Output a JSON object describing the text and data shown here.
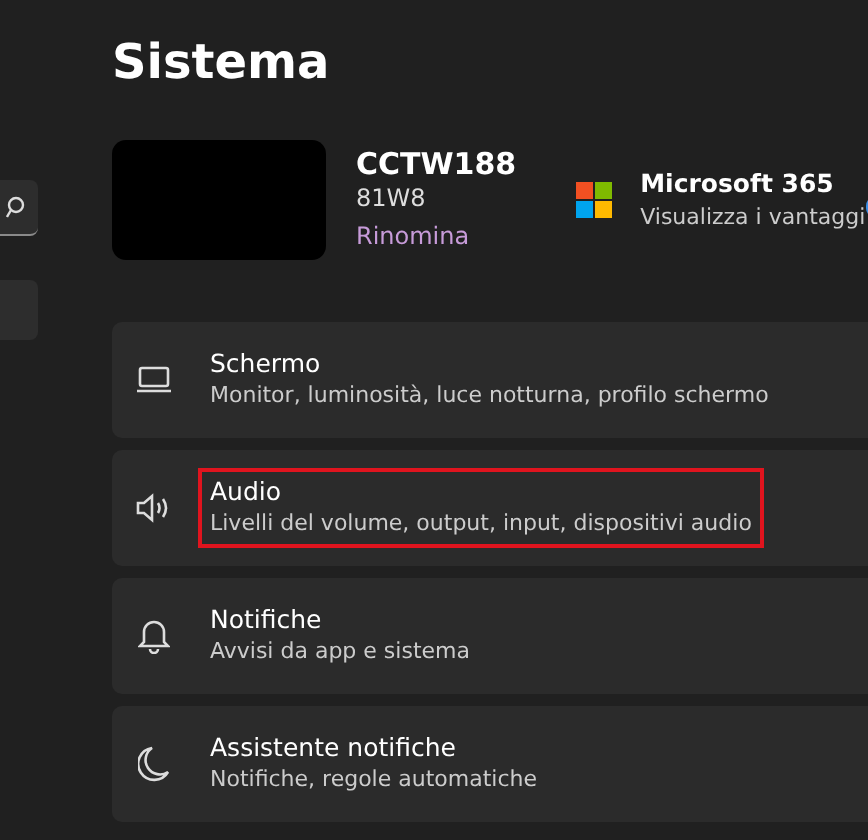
{
  "title": "Sistema",
  "device": {
    "name": "CCTW188",
    "model": "81W8",
    "rename_link": "Rinomina"
  },
  "promo": {
    "title": "Microsoft 365",
    "subtitle": "Visualizza i vantaggi"
  },
  "settings": [
    {
      "kind": "display",
      "title": "Schermo",
      "subtitle": "Monitor, luminosità, luce notturna, profilo schermo",
      "highlighted": false
    },
    {
      "kind": "sound",
      "title": "Audio",
      "subtitle": "Livelli del volume, output, input, dispositivi audio",
      "highlighted": true
    },
    {
      "kind": "notifications",
      "title": "Notifiche",
      "subtitle": "Avvisi da app e sistema",
      "highlighted": false
    },
    {
      "kind": "focus",
      "title": "Assistente notifiche",
      "subtitle": "Notifiche, regole automatiche",
      "highlighted": false
    }
  ]
}
